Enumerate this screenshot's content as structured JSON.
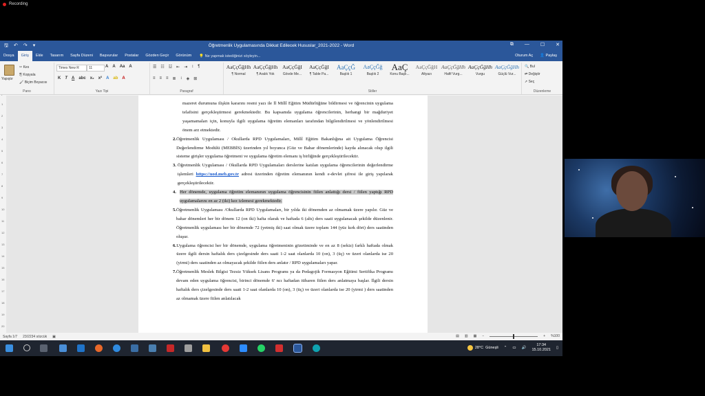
{
  "recording": {
    "label": "Recording"
  },
  "window": {
    "title": "Öğretmenlik Uygulamasında Dikkat Edilecek Hususlar_2021-2022 - Word",
    "controls": {
      "restore": "⧉",
      "minimize": "—",
      "maximize": "☐",
      "close": "✕"
    }
  },
  "menu": {
    "tabs": [
      "Dosya",
      "Giriş",
      "Ekle",
      "Tasarım",
      "Sayfa Düzeni",
      "Başvurular",
      "Postalar",
      "Gözden Geçir",
      "Görünüm"
    ],
    "active": "Giriş",
    "tell_me": "Ne yapmak istediğinizi söyleyin...",
    "user": "Oturum Aç",
    "share": "Paylaş"
  },
  "ribbon": {
    "clipboard": {
      "paste": "Yapıştır",
      "cut": "Kes",
      "copy": "Kopyala",
      "format_painter": "Biçim Boyacısı",
      "label": "Pano"
    },
    "font": {
      "name": "Times New R",
      "size": "11",
      "label": "Yazı Tipi"
    },
    "paragraph": {
      "label": "Paragraf"
    },
    "styles": {
      "label": "Stiller",
      "items": [
        {
          "preview": "AaÇçĞğHh",
          "name": "¶ Normal"
        },
        {
          "preview": "AaÇçĞğHh",
          "name": "¶ Aralık Yok"
        },
        {
          "preview": "AaÇçĞğI",
          "name": "Gövde Me..."
        },
        {
          "preview": "AaÇçĞğI",
          "name": "¶ Table Pa..."
        },
        {
          "preview": "AaÇçĞ",
          "name": "Başlık 1"
        },
        {
          "preview": "AaÇçĞğ",
          "name": "Başlık 2"
        },
        {
          "preview": "AaÇ",
          "name": "Konu Başlı..."
        },
        {
          "preview": "AaÇçĞğH",
          "name": "Altyazı"
        },
        {
          "preview": "AaÇçĞğHh",
          "name": "Hafif Vurg..."
        },
        {
          "preview": "AaÇçĞğHh",
          "name": "Vurgu"
        },
        {
          "preview": "AaÇçĞğHh",
          "name": "Güçlü Vur..."
        }
      ]
    },
    "editing": {
      "find": "Bul",
      "replace": "Değiştir",
      "select": "Seç",
      "label": "Düzenleme"
    }
  },
  "ruler": {
    "ticks": [
      "L",
      "1",
      "2",
      "3",
      "4",
      "5",
      "6",
      "7",
      "8",
      "9",
      "10",
      "11",
      "12",
      "13",
      "14",
      "15",
      "16",
      "17",
      "18"
    ]
  },
  "vruler": {
    "ticks": [
      "1",
      "2",
      "3",
      "4",
      "5",
      "6",
      "7",
      "8",
      "9",
      "10",
      "11",
      "12",
      "13",
      "14",
      "15",
      "16",
      "17",
      "18",
      "19",
      "20"
    ]
  },
  "document": {
    "intro": "mazeret durumuna ilişkin kararını resmi yazı ile İl Millî Eğitim Müdürlüğüne bildirmesi ve öğrencinin uygulama telafisini gerçekleştirmesi gerekmektedir. Bu kapsamda uygulama öğrencilerinin, herhangi bir mağduriyet yaşamamaları için, konuyla ilgili uygulama öğretim elemanları tarafından bilgilendirilmesi ve yönlendirilmesi önem arz etmektedir.",
    "items": [
      {
        "num": "2.",
        "text": "Öğretmenlik Uygulaması / Okullarda RPD Uygulamaları, Millî Eğitim Bakanlığına ait Uygulama Öğrencisi Değerlendirme Modülü (MEBBİS) üzerinden yıl boyunca (Güz ve Bahar dönemlerinde) kayda alınacak olup ilgili sisteme girişler uygulama öğretmeni ve uygulama öğretim elemanı iş birliğinde gerçekleştirilecektir."
      },
      {
        "num": "3.",
        "pre": "Öğretmenlik Uygulaması / Okullarda RPD Uygulamaları derslerine katılan uygulama öğrencilerinin değerlendirme işlemleri ",
        "link": "https://uod.meb.gov.tr",
        "post": " adresi üzerinden öğretim elemanının kendi e-devlet şifresi ile giriş yapılarak gerçekleştirilecektir."
      },
      {
        "num": "4.",
        "text": "Her dönemde, uygulama öğretim elemanının uygulama öğrencisinin fiilen anlattığı dersi / fiilen yaptığı RPD uygulamalarını en az 2 (iki) kez izlemesi gerekmektedir."
      },
      {
        "num": "5.",
        "text": "Öğretmenlik Uygulaması /Okullarda RPD Uygulamaları, bir yılda iki dönemden az olmamak üzere yapılır. Güz ve bahar dönemleri her bir dönem 12 (on iki) hafta olarak ve haftada 6 (altı) ders saati uygulanacak şekilde düzenlenir. Öğretmenlik uygulaması her bir dönemde 72 (yetmiş iki) saat olmak üzere toplam 144 (yüz kırk dört) ders saatinden oluşur."
      },
      {
        "num": "6.",
        "text": "Uygulama öğrencisi her bir dönemde, uygulama öğretmeninin gözetiminde ve en az 8 (sekiz) farklı haftada olmak üzere ilgili dersin haftalık ders çizelgesinde ders saati 1-2 saat olanlarda 10 (on), 3 (üç) ve üzeri olanlarda ise 20 (yirmi) ders saatinden az olmayacak şekilde fiilen ders anlatır / RPD uygulamaları yapar."
      },
      {
        "num": "7.",
        "text": "Öğretmenlik Meslek Bilgisi Tezsiz Yüksek Lisans Programı ya da Pedagojik Formasyon Eğitimi Sertifika Programı devam eden uygulama öğrencisi, birinci dönemde 6' ncı haftadan itibaren fiilen ders anlatmaya başlar. İlgili dersin haftalık ders çizelgesinde ders saati 1-2 saat olanlarda 10 (on), 3 (üç) ve üzeri olanlarda ise 20 (yirmi ) ders saatinden az olmamak üzere fiilen anlatılacak"
      }
    ]
  },
  "status": {
    "page": "Sayfa 1/7",
    "words": "23/2234 sözcük",
    "zoom": "%100"
  },
  "taskbar": {
    "temp": "28°C",
    "weather": "Güneşli",
    "time": "17:34",
    "date": "15.10.2021"
  }
}
